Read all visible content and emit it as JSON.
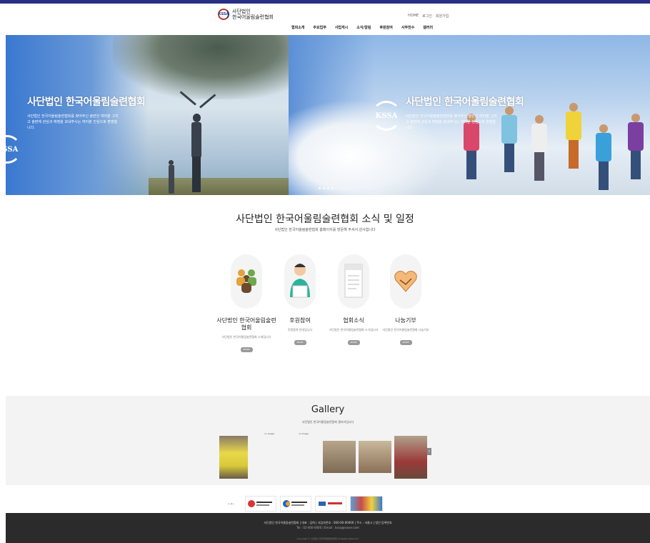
{
  "header": {
    "logo_line1": "사단법인",
    "logo_line2": "한국어울림술련협회",
    "logo_mark": "KSSA",
    "util_links": [
      "HOME",
      "로그인",
      "회원가입"
    ],
    "nav": [
      "협회소개",
      "주요업무",
      "사업게시",
      "소식/알림",
      "후원참여",
      "사무전수",
      "갤러리"
    ]
  },
  "hero": {
    "slide1_title": "사단법인 한국어울림술련협회",
    "slide1_desc": "사단법인 한국어울림술련협회를 찾아주신 술련인 여러분 그리고 술련에 관심과 애정을 보내주시는 여러분 진심으로 환영합니다.",
    "slide2_title": "사단법인 한국어울림술련협회",
    "slide2_desc": "사단법인 한국어울림술련협회를 찾아주신 술련인 여러분 그리고 술련에 관심과 애정을 보내주시는 여러분 진심으로 환영합니다.",
    "slide_mark": "KSSA"
  },
  "news": {
    "title": "사단법인 한국어울림술련협회 소식 및 일정",
    "subtitle": "사단법인 한국어울림술련협회 홈페이지를 방문해 주셔서 감사합니다",
    "cards": [
      {
        "name": "사단법인 한국어울림술련협회",
        "desc": "사단법인 한국어울림술련협회 소개입니다",
        "more": "MORE"
      },
      {
        "name": "후원참여",
        "desc": "후원참여 안내입니다",
        "more": "MORE"
      },
      {
        "name": "협회소식",
        "desc": "사단법인 한국어울림술련협회 소식입니다",
        "more": "MORE"
      },
      {
        "name": "나눔기부",
        "desc": "사단법인 한국어울림술련협회 나눔기부",
        "more": "MORE"
      }
    ]
  },
  "gallery": {
    "title": "Gallery",
    "subtitle": "사단법인 한국어울림술련협회 갤러리입니다",
    "no_image": "no image",
    "next": "›"
  },
  "footer": {
    "line1": "사단법인 한국어울림술련협회 | 대표 : 김희 | 사업자번호 : 000-00-00000 | 주소 : 서울시 | 법인 등록번호",
    "line2": "Tel : 02-000-0000 | Email : kssa@naver.com",
    "line3": "Copyright © 사단법인 한국어울림술련협회 All Rights Reserved."
  }
}
